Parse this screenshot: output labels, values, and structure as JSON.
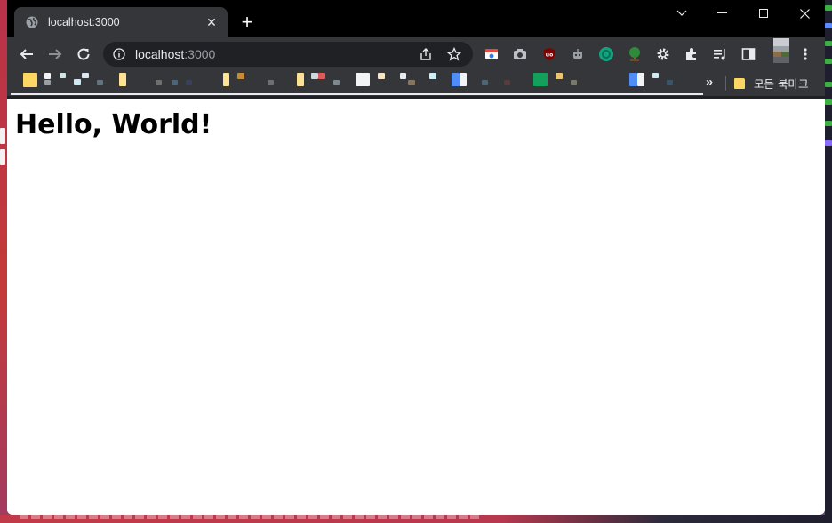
{
  "tab": {
    "title": "localhost:3000",
    "favicon": "globe-icon",
    "close": "✕"
  },
  "new_tab": "+",
  "window_controls": [
    "chevron-down-icon",
    "minimize-icon",
    "maximize-icon",
    "close-icon"
  ],
  "omnibox": {
    "host": "localhost",
    "port": ":3000",
    "actions": [
      "share-icon",
      "star-icon"
    ]
  },
  "extensions": [
    "chrome-icon",
    "camera-icon",
    "ublock-icon",
    "robot-icon",
    "openai-icon",
    "tree-icon",
    "gear-icon",
    "puzzle-icon",
    "media-icon",
    "sidepanel-icon",
    "profile-avatar",
    "more-vert-icon"
  ],
  "bookmarks": {
    "more": "»",
    "all_bookmarks": "모든 북마크"
  },
  "page": {
    "heading": "Hello, World!"
  },
  "colors": {
    "tabstrip": "#000000",
    "toolbar": "#35363a",
    "omnibox": "#202124",
    "text": "#e8eaed",
    "folder": "#fdd663"
  }
}
